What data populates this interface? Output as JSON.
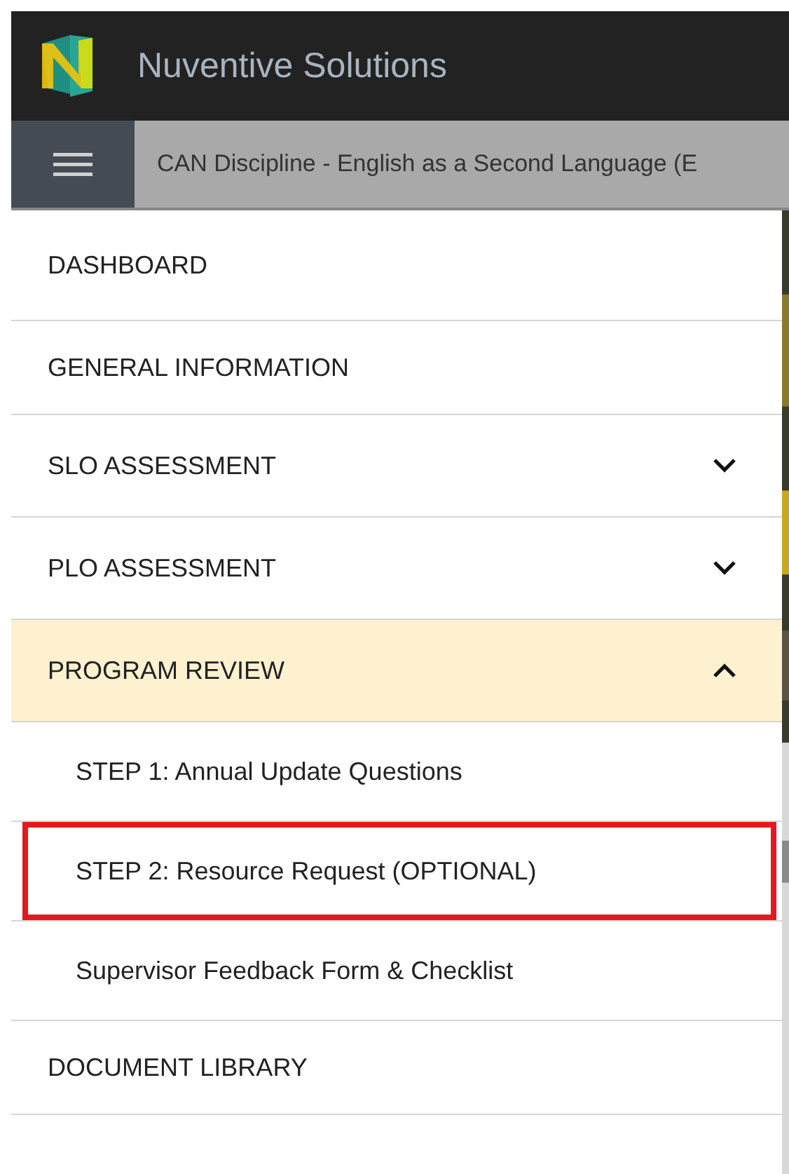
{
  "header": {
    "title": "Nuventive Solutions"
  },
  "subheader": {
    "title": "CAN Discipline - English as a Second Language (E"
  },
  "menu": {
    "items": [
      {
        "kind": "link",
        "label": "DASHBOARD"
      },
      {
        "kind": "link",
        "label": "GENERAL INFORMATION"
      },
      {
        "kind": "group",
        "label": "SLO ASSESSMENT",
        "expanded": false
      },
      {
        "kind": "group",
        "label": "PLO ASSESSMENT",
        "expanded": false
      },
      {
        "kind": "group",
        "label": "PROGRAM REVIEW",
        "expanded": true,
        "children": [
          {
            "label": "STEP 1: Annual Update Questions",
            "annotated": false
          },
          {
            "label": "STEP 2: Resource Request (OPTIONAL)",
            "annotated": true
          },
          {
            "label": "Supervisor Feedback Form & Checklist",
            "annotated": false
          }
        ]
      },
      {
        "kind": "link",
        "label": "DOCUMENT LIBRARY"
      }
    ]
  }
}
